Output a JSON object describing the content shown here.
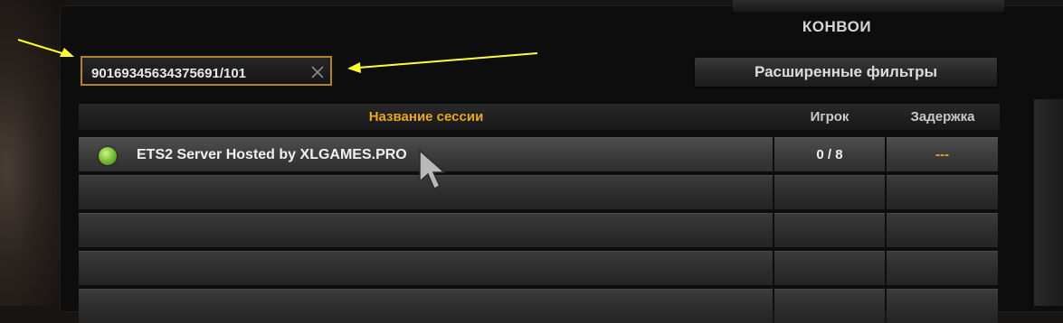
{
  "header": {
    "title": "КОНВОИ"
  },
  "search": {
    "value": "90169345634375691/101"
  },
  "filters": {
    "label": "Расширенные фильтры"
  },
  "table": {
    "columns": {
      "name": "Название сессии",
      "players": "Игрок",
      "delay": "Задержка"
    },
    "rows": [
      {
        "name": "ETS2 Server Hosted by XLGAMES.PRO",
        "players": "0 / 8",
        "delay": "---",
        "status": "online"
      }
    ],
    "empty_rows": 4
  },
  "colors": {
    "accent": "#e8a624",
    "border_highlight": "#b2832e",
    "annotation": "#ffff33",
    "status_online": "#7cc43a"
  },
  "icons": {
    "clear": "close-icon",
    "status": "status-dot-icon",
    "cursor": "mouse-cursor-icon",
    "arrows": "annotation-arrow"
  }
}
